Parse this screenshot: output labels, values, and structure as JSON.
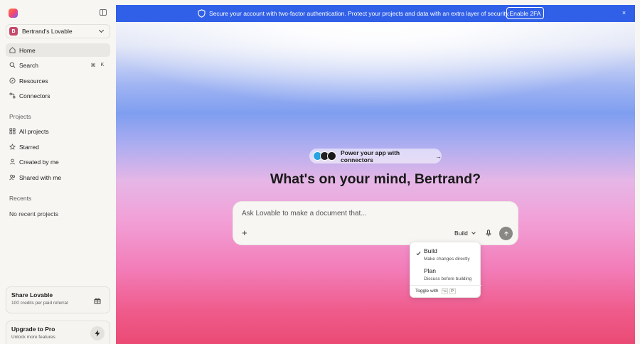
{
  "sidebar": {
    "workspace": {
      "initial": "B",
      "name": "Bertrand's Lovable"
    },
    "nav": {
      "home": "Home",
      "search": "Search",
      "search_kbd": [
        "⌘",
        "K"
      ],
      "resources": "Resources",
      "connectors": "Connectors"
    },
    "projects": {
      "label": "Projects",
      "all": "All projects",
      "starred": "Starred",
      "created": "Created by me",
      "shared": "Shared with me"
    },
    "recents": {
      "label": "Recents",
      "empty": "No recent projects"
    },
    "share_card": {
      "title": "Share Lovable",
      "subtitle": "100 credits per paid referral"
    },
    "pro_card": {
      "title": "Upgrade to Pro",
      "subtitle": "Unlock more features"
    }
  },
  "banner": {
    "text": "Secure your account with two-factor authentication. Protect your projects and data with an extra layer of security.",
    "button": "Enable 2FA",
    "close": "×",
    "color": "#3160e8"
  },
  "main": {
    "pill": {
      "text": "Power your app with connectors",
      "arrow": "→"
    },
    "headline": "What's on your mind, Bertrand?",
    "prompt": {
      "placeholder": "Ask Lovable to make a document that...",
      "mode": "Build"
    },
    "mode_menu": {
      "items": [
        {
          "title": "Build",
          "desc": "Make changes directly",
          "selected": true
        },
        {
          "title": "Plan",
          "desc": "Discuss before building",
          "selected": false
        }
      ],
      "toggle_label": "Toggle with",
      "toggle_keys": [
        "⌥",
        "P"
      ]
    }
  }
}
